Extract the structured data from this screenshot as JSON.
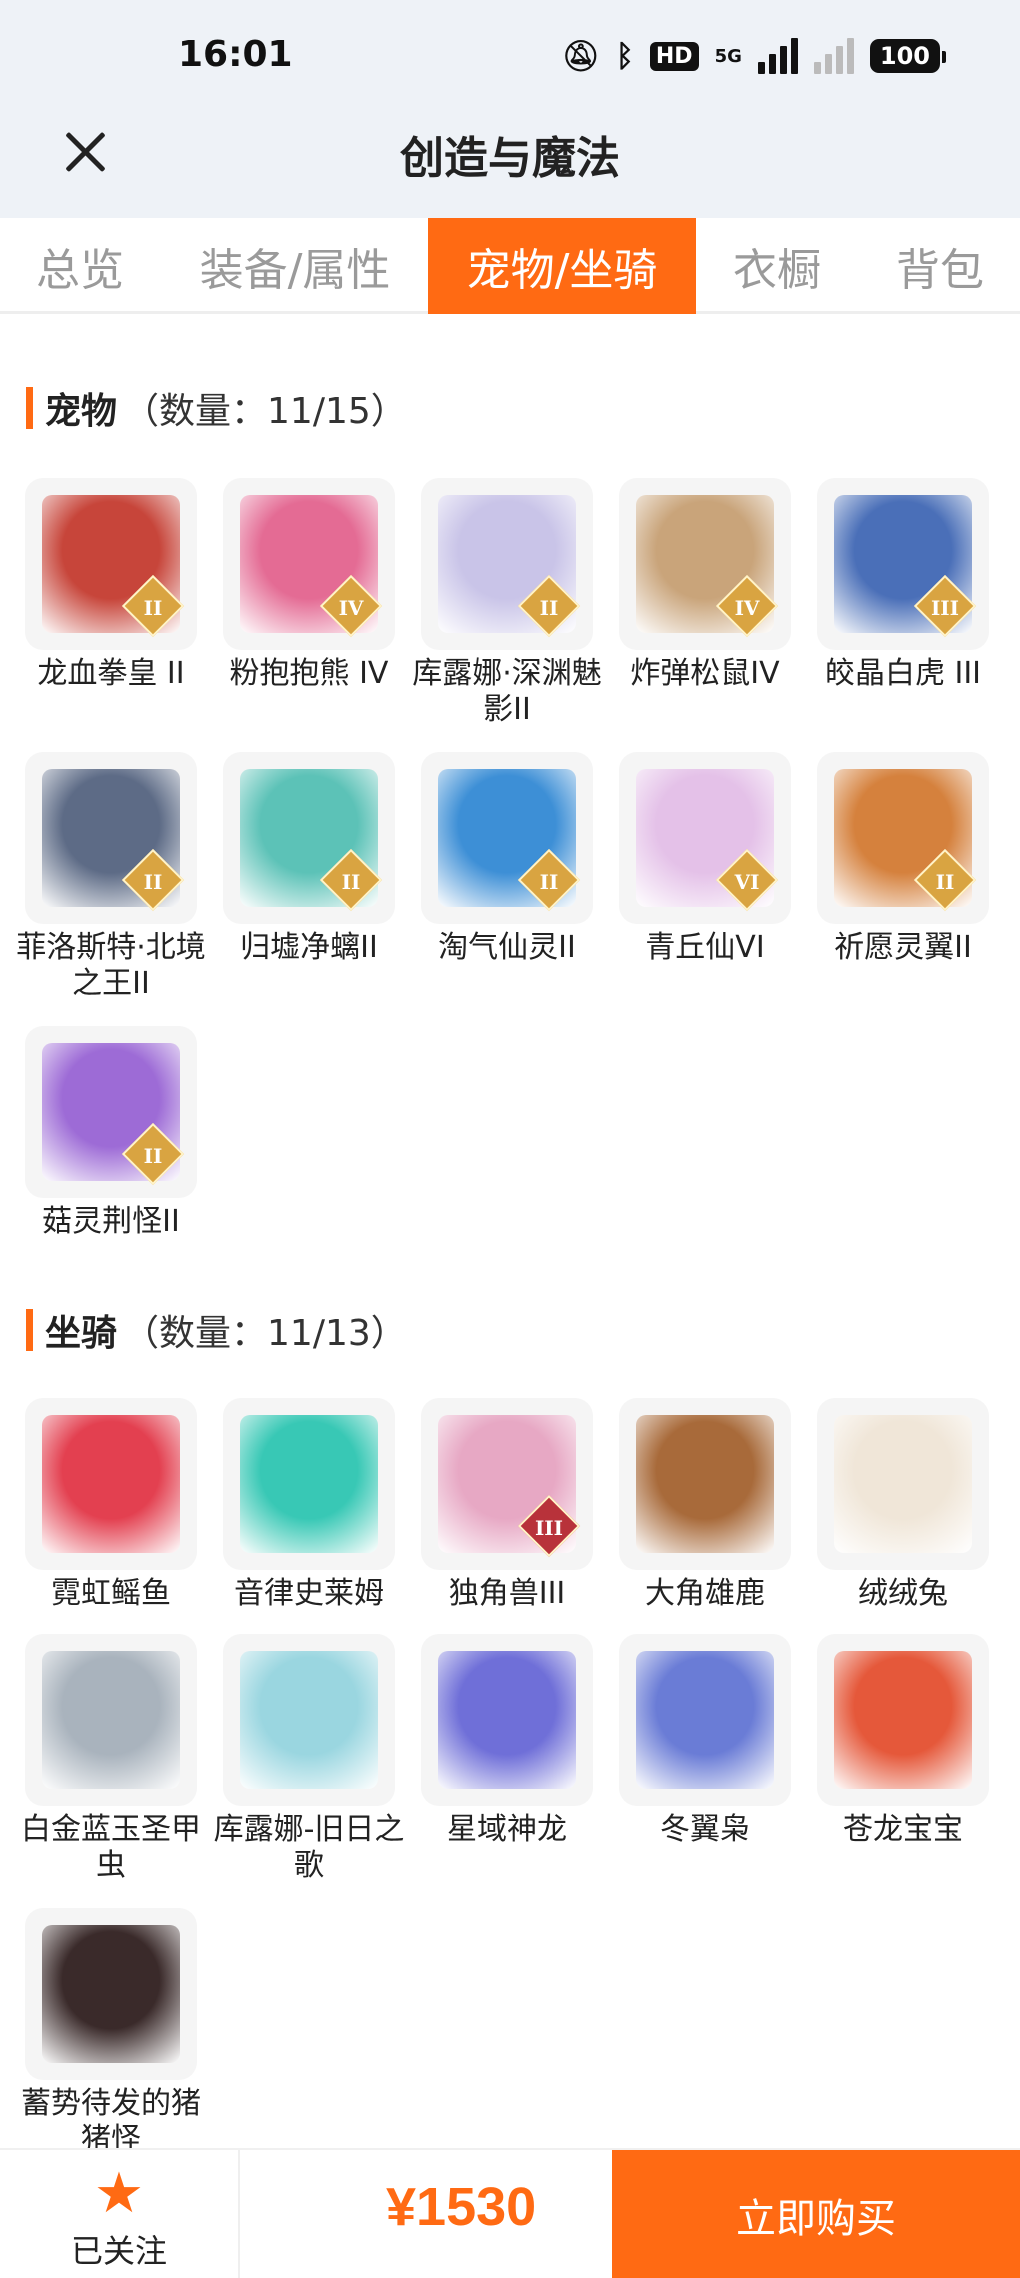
{
  "status": {
    "time": "16:01",
    "network": "5G",
    "battery": "100"
  },
  "header": {
    "title": "创造与魔法"
  },
  "tabs": [
    {
      "label": "总览",
      "active": false
    },
    {
      "label": "装备/属性",
      "active": false
    },
    {
      "label": "宠物/坐骑",
      "active": true
    },
    {
      "label": "衣橱",
      "active": false
    },
    {
      "label": "背包",
      "active": false
    }
  ],
  "pets": {
    "title": "宠物",
    "count": "（数量：11/15）",
    "items": [
      {
        "name": "龙血拳皇 II",
        "badge": "II",
        "color": "#c7453a"
      },
      {
        "name": "粉抱抱熊 IV",
        "badge": "IV",
        "color": "#e46b94"
      },
      {
        "name": "库露娜·深渊魅影II",
        "badge": "II",
        "color": "#c9c4e8"
      },
      {
        "name": "炸弹松鼠IV",
        "badge": "IV",
        "color": "#c9a47a"
      },
      {
        "name": "皎晶白虎 III",
        "badge": "III",
        "color": "#4a6fb8"
      },
      {
        "name": "菲洛斯特·北境之王II",
        "badge": "II",
        "color": "#5d6b86"
      },
      {
        "name": "归墟净螭II",
        "badge": "II",
        "color": "#5cc2b7"
      },
      {
        "name": "淘气仙灵II",
        "badge": "II",
        "color": "#3d8fd6"
      },
      {
        "name": "青丘仙VI",
        "badge": "VI",
        "color": "#e4c1e8"
      },
      {
        "name": "祈愿灵翼II",
        "badge": "II",
        "color": "#d5813d"
      },
      {
        "name": "菇灵荆怪II",
        "badge": "II",
        "color": "#9d6bd6"
      }
    ]
  },
  "mounts": {
    "title": "坐骑",
    "count": "（数量：11/13）",
    "items": [
      {
        "name": "霓虹鳐鱼",
        "badge": "",
        "color": "#e34050"
      },
      {
        "name": "音律史莱姆",
        "badge": "",
        "color": "#38c8b5"
      },
      {
        "name": "独角兽III",
        "badge": "III",
        "color": "#e7a8c4"
      },
      {
        "name": "大角雄鹿",
        "badge": "",
        "color": "#a86a3a"
      },
      {
        "name": "绒绒兔",
        "badge": "",
        "color": "#f0e6d8"
      },
      {
        "name": "白金蓝玉圣甲虫",
        "badge": "",
        "color": "#a9b3bd"
      },
      {
        "name": "库露娜-旧日之歌",
        "badge": "",
        "color": "#9ad6e0"
      },
      {
        "name": "星域神龙",
        "badge": "",
        "color": "#6f6fd8"
      },
      {
        "name": "冬翼枭",
        "badge": "",
        "color": "#6a7cd6"
      },
      {
        "name": "苍龙宝宝",
        "badge": "",
        "color": "#e5583a"
      },
      {
        "name": "蓄势待发的猪猪怪",
        "badge": "",
        "color": "#3a2a2a"
      }
    ]
  },
  "footer": {
    "follow_label": "已关注",
    "price": "¥1530",
    "buy_label": "立即购买"
  },
  "colors": {
    "accent": "#ff6a13"
  }
}
